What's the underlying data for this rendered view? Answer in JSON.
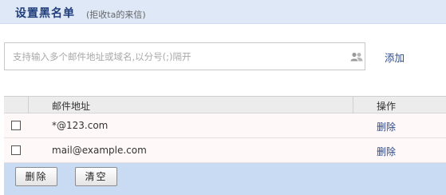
{
  "header": {
    "title": "设置黑名单",
    "subtitle": "(拒收ta的来信)"
  },
  "input": {
    "value": "",
    "placeholder": "支持输入多个邮件地址或域名,以分号(;)隔开"
  },
  "add_label": "添加",
  "table": {
    "columns": [
      "邮件地址",
      "操作"
    ],
    "rows": [
      {
        "email": "*@123.com",
        "action": "删除",
        "checked": false
      },
      {
        "email": "mail@example.com",
        "action": "删除",
        "checked": false
      }
    ]
  },
  "footer": {
    "delete_label": "删除",
    "clear_label": "清空"
  },
  "icons": {
    "contacts": "contacts-icon"
  },
  "colors": {
    "header_bg": "#dfe8f6",
    "title": "#1f3d7a",
    "link": "#2a4a8a",
    "footer_bg": "#c9daf3"
  }
}
